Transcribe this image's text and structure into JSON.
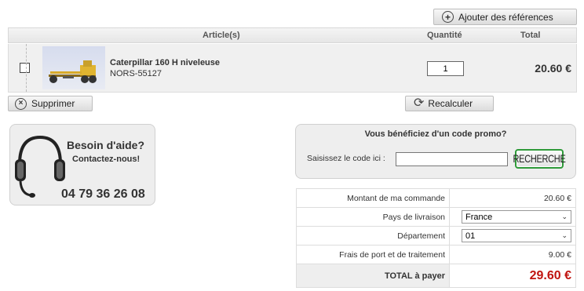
{
  "toolbar": {
    "add_refs_label": "Ajouter des références"
  },
  "cart": {
    "columns": {
      "article": "Article(s)",
      "quantity": "Quantité",
      "total": "Total"
    },
    "item": {
      "name": "Caterpillar 160 H niveleuse",
      "ref": "NORS-55127",
      "quantity": "1",
      "total": "20.60 €"
    },
    "delete_label": "Supprimer",
    "recalc_label": "Recalculer"
  },
  "help": {
    "title": "Besoin d'aide?",
    "subtitle": "Contactez-nous!",
    "phone": "04 79 36 26 08"
  },
  "promo": {
    "title": "Vous bénéficiez d'un code promo?",
    "input_label": "Saisissez le code ici :",
    "input_value": "",
    "search_label": "RECHERCHE"
  },
  "summary": {
    "order_amount_label": "Montant de ma commande",
    "order_amount": "20.60 €",
    "country_label": "Pays de livraison",
    "country_value": "France",
    "department_label": "Département",
    "department_value": "01",
    "shipping_label": "Frais de port et de traitement",
    "shipping_value": "9.00 €",
    "total_label": "TOTAL à payer",
    "total_value": "29.60 €"
  },
  "colors": {
    "total_red": "#c0140f",
    "search_green": "#2f9a3a"
  }
}
